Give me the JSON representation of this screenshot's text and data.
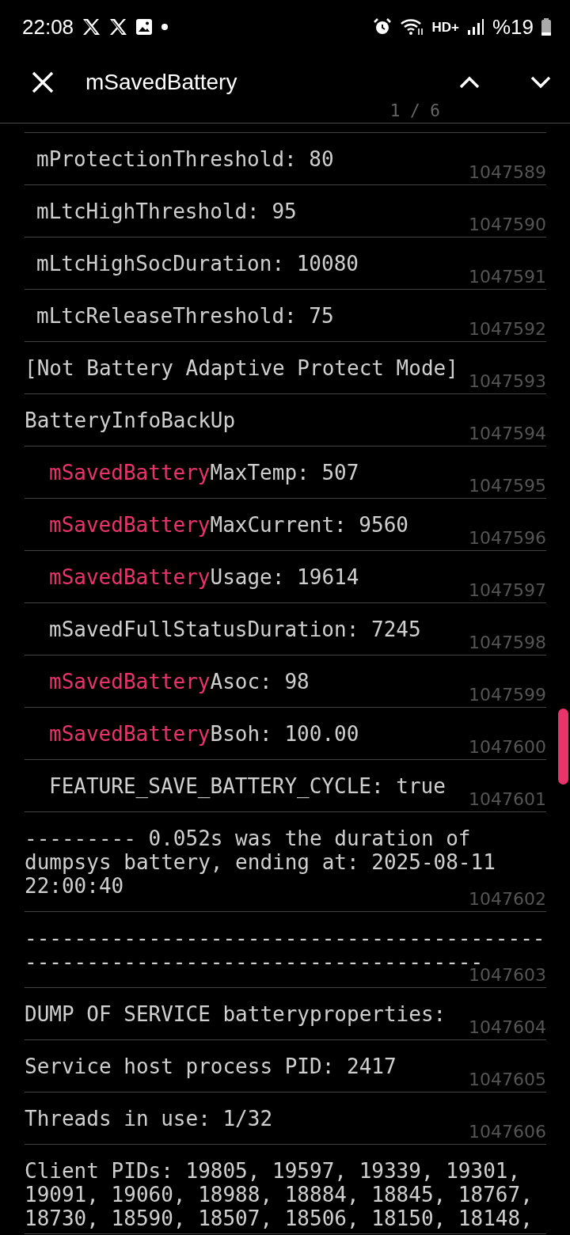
{
  "status_bar": {
    "time": "22:08",
    "network_label": "HD+",
    "battery_text": "%19"
  },
  "search": {
    "value": "mSavedBattery",
    "counter": "1 / 6"
  },
  "log_lines": [
    {
      "kind": "child",
      "number": "1047589",
      "text": "mProtectionThreshold: 80"
    },
    {
      "kind": "child",
      "number": "1047590",
      "text": "mLtcHighThreshold: 95"
    },
    {
      "kind": "child",
      "number": "1047591",
      "text": "mLtcHighSocDuration: 10080"
    },
    {
      "kind": "child",
      "number": "1047592",
      "text": "mLtcReleaseThreshold: 75"
    },
    {
      "kind": "top",
      "number": "1047593",
      "text": "[Not Battery Adaptive Protect Mode]"
    },
    {
      "kind": "top",
      "number": "1047594",
      "text": "BatteryInfoBackUp"
    },
    {
      "kind": "grandchild",
      "number": "1047595",
      "match": "mSavedBattery",
      "text": "MaxTemp: 507"
    },
    {
      "kind": "grandchild",
      "number": "1047596",
      "match": "mSavedBattery",
      "text": "MaxCurrent: 9560"
    },
    {
      "kind": "grandchild",
      "number": "1047597",
      "match": "mSavedBattery",
      "text": "Usage: 19614"
    },
    {
      "kind": "grandchild",
      "number": "1047598",
      "text": "mSavedFullStatusDuration: 7245"
    },
    {
      "kind": "grandchild",
      "number": "1047599",
      "match": "mSavedBattery",
      "text": "Asoc: 98"
    },
    {
      "kind": "grandchild",
      "number": "1047600",
      "match": "mSavedBattery",
      "text": "Bsoh: 100.00"
    },
    {
      "kind": "grandchild",
      "number": "1047601",
      "text": "FEATURE_SAVE_BATTERY_CYCLE: true"
    },
    {
      "kind": "top",
      "number": "1047602",
      "text": "--------- 0.052s was the duration of dumpsys battery, ending at: 2025-08-11 22:00:40"
    },
    {
      "kind": "top",
      "number": "1047603",
      "text": "-------------------------------------------------------------------------------"
    },
    {
      "kind": "top",
      "number": "1047604",
      "text": "DUMP OF SERVICE batteryproperties:"
    },
    {
      "kind": "top",
      "number": "1047605",
      "text": "Service host process PID: 2417"
    },
    {
      "kind": "top",
      "number": "1047606",
      "text": "Threads in use: 1/32"
    },
    {
      "kind": "top",
      "text": "Client PIDs: 19805, 19597, 19339, 19301, 19091, 19060, 18988, 18884, 18845, 18767, 18730, 18590, 18507, 18506, 18150, 18148,"
    }
  ]
}
